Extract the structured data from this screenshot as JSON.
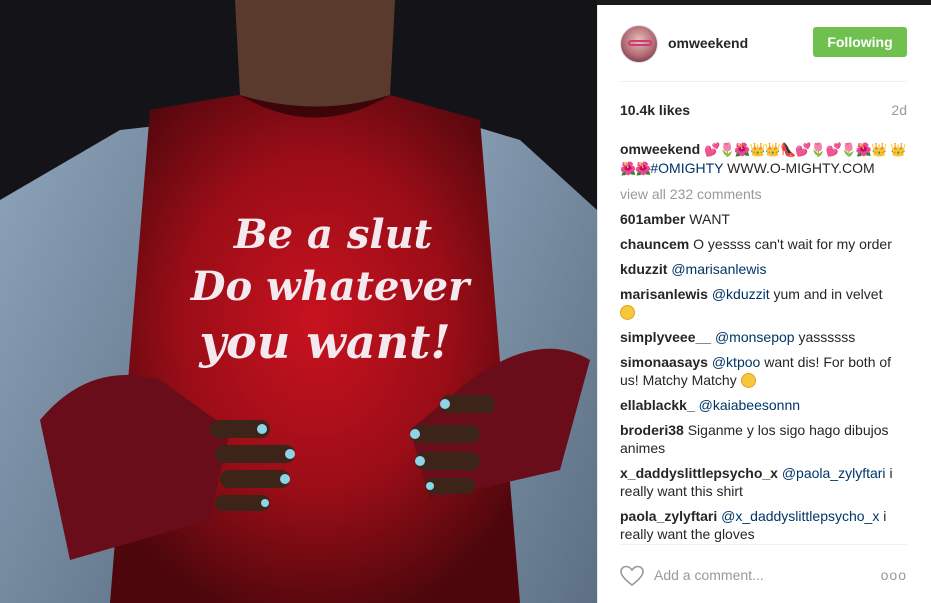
{
  "post": {
    "username": "omweekend",
    "follow_label": "Following",
    "likes": "10.4k likes",
    "time_ago": "2d",
    "shirt_text": [
      "Be a slut",
      "Do whatever",
      "you want!"
    ]
  },
  "caption": {
    "user": "omweekend",
    "emojis": "💕🌷🌺👑👑👠💕🌷💕🌷🌺👑",
    "emojis2": "👑🌺🌺",
    "hashtag": "#OMIGHTY",
    "link": "WWW.O-MIGHTY.COM"
  },
  "view_all": "view all 232 comments",
  "comments": [
    {
      "user": "601amber",
      "text": "WANT"
    },
    {
      "user": "chauncem",
      "text": "O yessss can't wait for my order"
    },
    {
      "user": "kduzzit",
      "mention": "@marisanlewis",
      "text": ""
    },
    {
      "user": "marisanlewis",
      "mention": "@kduzzit",
      "text": "yum and in velvet"
    },
    {
      "user": "simplyveee__",
      "mention": "@monsepop",
      "text": "yassssss"
    },
    {
      "user": "simonaasays",
      "mention": "@ktpoo",
      "text": "want dis! For both of us! Matchy Matchy"
    },
    {
      "user": "ellablackk_",
      "mention": "@kaiabeesonnn",
      "text": ""
    },
    {
      "user": "broderi38",
      "text": "Siganme y los sigo hago dibujos animes"
    },
    {
      "user": "x_daddyslittlepsycho_x",
      "mention": "@paola_zylyftari",
      "text": "i really want this shirt"
    },
    {
      "user": "paola_zylyftari",
      "mention": "@x_daddyslittlepsycho_x",
      "text": "i really want the gloves"
    }
  ],
  "footer": {
    "add_comment_placeholder": "Add a comment...",
    "more_label": "ooo"
  },
  "colors": {
    "follow": "#70c050",
    "mention": "#003569",
    "shirt": "#b0101c"
  }
}
